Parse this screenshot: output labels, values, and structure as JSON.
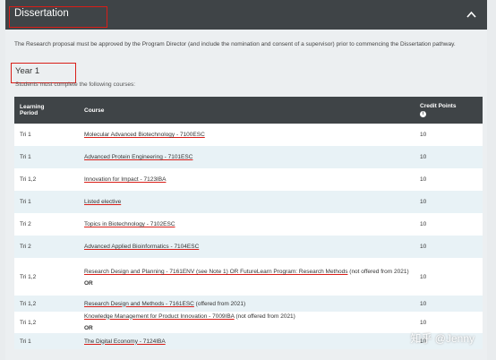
{
  "section": {
    "title": "Dissertation",
    "intro": "The Research proposal must be approved by the Program Director (and include the nomination and consent of a supervisor) prior to commencing the Dissertation pathway.",
    "year": "Year 1",
    "students_text": "Students must complete the following courses:"
  },
  "table": {
    "headers": {
      "period_line1": "Learning",
      "period_line2": "Period",
      "course": "Course",
      "credit": "Credit Points"
    },
    "rows": [
      {
        "period": "Tri 1",
        "course": "Molecular Advanced Biotechnology - 7100ESC",
        "credit": "10"
      },
      {
        "period": "Tri 1",
        "course": "Advanced Protein Engineering - 7101ESC",
        "credit": "10"
      },
      {
        "period": "Tri 1,2",
        "course": "Innovation for Impact - 7123IBA",
        "credit": "10"
      },
      {
        "period": "Tri 1",
        "course": "Listed elective",
        "credit": "10"
      },
      {
        "period": "Tri 2",
        "course": "Topics in Biotechnology - 7102ESC",
        "credit": "10"
      },
      {
        "period": "Tri 2",
        "course": "Advanced Applied Bioinformatics - 7104ESC",
        "credit": "10"
      },
      {
        "period": "Tri 1,2",
        "course_a_link": "Research Design and Planning - 7161ENV (see Note 1) OR FutureLearn Program: Research Methods",
        "course_a_tail": " (not offered from 2021)",
        "or": "OR",
        "credit": "10"
      },
      {
        "period": "Tri 1,2",
        "course_link": "Research Design and Methods - 7161ESC",
        "course_tail": " (offered from 2021)",
        "credit": "10"
      },
      {
        "period": "Tri 1,2",
        "course_link": "Knowledge Management for Product Innovation - 7009IBA",
        "course_tail": " (not offered from 2021)",
        "or": "OR",
        "credit": "10"
      },
      {
        "period": "Tri 1",
        "course": "The Digital Economy - 7124IBA",
        "credit": "10"
      }
    ]
  },
  "watermark": "知乎 @Jenny",
  "colors": {
    "header_bg": "#3f4447",
    "accent_red": "#d91e18",
    "row_alt": "#e8f2f6"
  }
}
